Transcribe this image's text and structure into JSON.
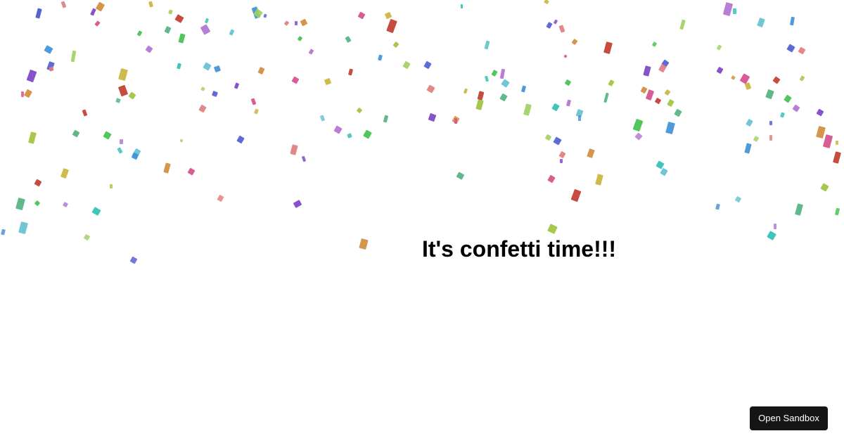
{
  "headline": "It's confetti time!!!",
  "sandbox_button": {
    "label": "Open Sandbox"
  },
  "colors": {
    "background": "#ffffff",
    "text": "#000000",
    "button_bg": "#151515",
    "button_text": "#ffffff",
    "confetti_palette": [
      "#c0392b",
      "#d64a8a",
      "#7b3fc4",
      "#4a5bd0",
      "#3d8fd6",
      "#2bbfb3",
      "#3fbf4a",
      "#9cc23a",
      "#c9b23a",
      "#d08a3a",
      "#e07b7b",
      "#a0d060",
      "#60c0d0",
      "#b070d0",
      "#50b080"
    ]
  }
}
